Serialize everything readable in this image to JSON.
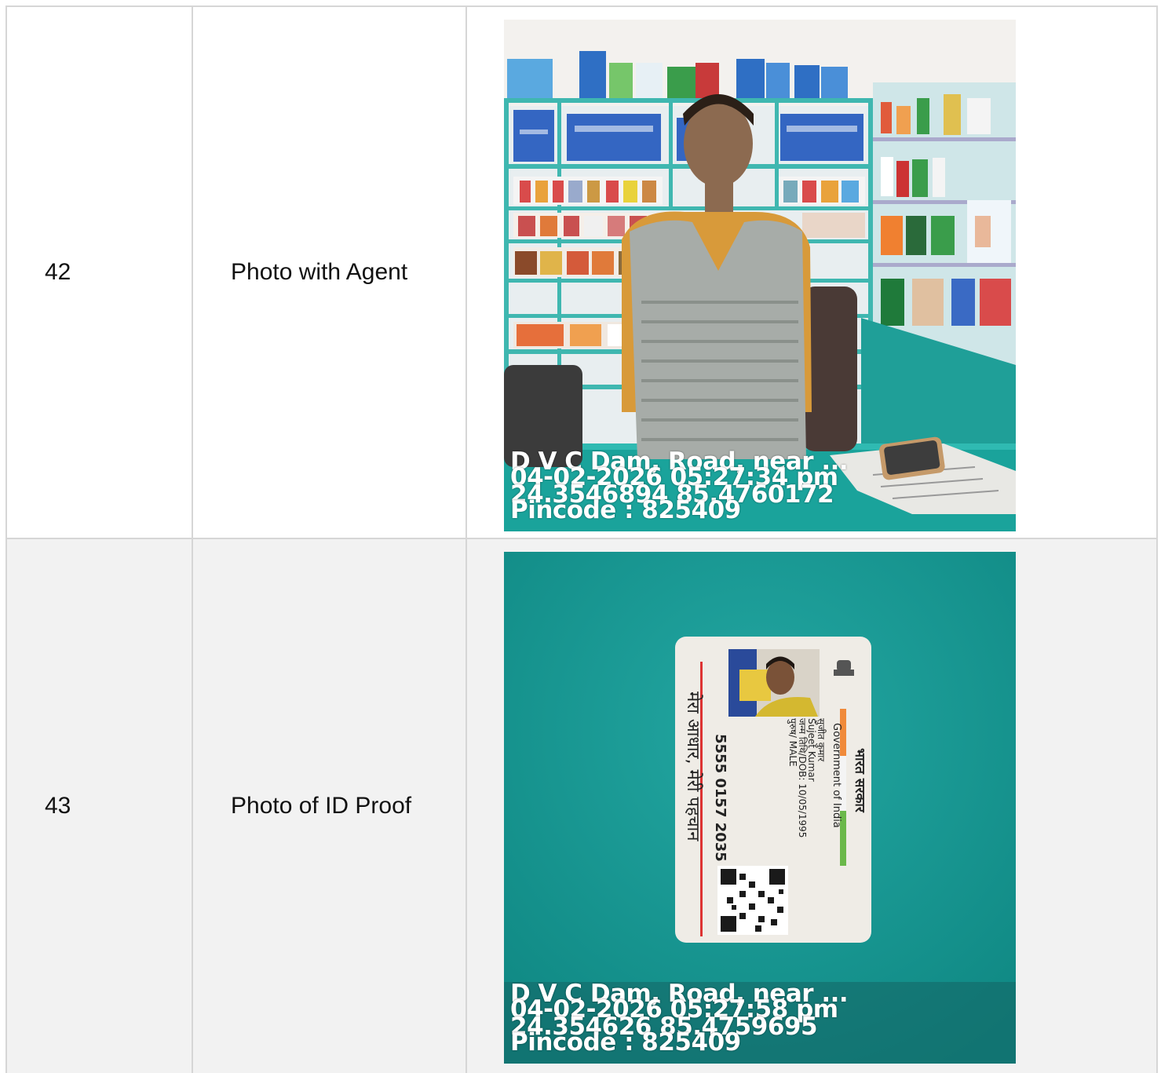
{
  "rows": [
    {
      "number": "42",
      "label": "Photo with Agent",
      "stamp": {
        "location": "D V C Dam, Road, near ...",
        "datetime": "04-02-2026 05:27:34 pm",
        "coords": "24.3546894 85.4760172",
        "pincode": "Pincode : 825409"
      }
    },
    {
      "number": "43",
      "label": "Photo of ID Proof",
      "stamp": {
        "location": "D V C Dam, Road, near ...",
        "datetime": "04-02-2026 05:27:58 pm",
        "coords": "24.354626 85.4759695",
        "pincode": "Pincode : 825409"
      },
      "id_card": {
        "header_hindi": "भारत सरकार",
        "header_english": "Government of India",
        "name_hindi": "सुजीत कुमार",
        "name_english": "Sujeet Kumar",
        "dob": "जन्म तिथि/DOB: 10/05/1995",
        "gender": "पुरुष/ MALE",
        "number": "5555 0157 2035",
        "tagline": "मेरा आधार, मेरी पहचान"
      }
    }
  ],
  "colors": {
    "border": "#d6d6d6",
    "row_alt": "#f2f2f2",
    "teal_background": "#13908c",
    "shelf_teal": "#3fb7b0"
  }
}
